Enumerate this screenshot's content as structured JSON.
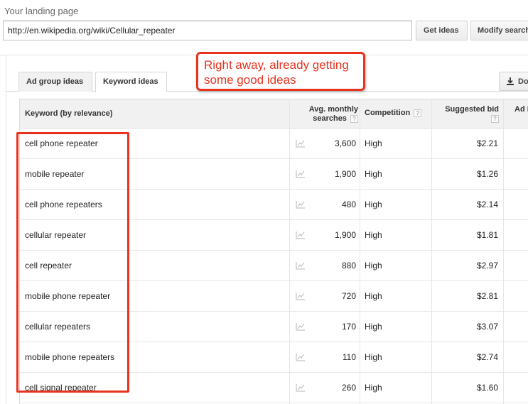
{
  "landing_page": {
    "label": "Your landing page",
    "url_value": "http://en.wikipedia.org/wiki/Cellular_repeater"
  },
  "buttons": {
    "get_ideas": "Get ideas",
    "modify_search": "Modify search",
    "download": "Download"
  },
  "tabs": [
    {
      "label": "Ad group ideas",
      "active": false
    },
    {
      "label": "Keyword ideas",
      "active": true
    }
  ],
  "table": {
    "headers": {
      "keyword": "Keyword (by relevance)",
      "avg_line1": "Avg. monthly",
      "avg_line2": "searches",
      "competition": "Competition",
      "bid": "Suggested bid",
      "ad_impr": "Ad i",
      "help": "?"
    },
    "rows": [
      {
        "keyword": "cell phone repeater",
        "searches": "3,600",
        "competition": "High",
        "bid": "$2.21"
      },
      {
        "keyword": "mobile repeater",
        "searches": "1,900",
        "competition": "High",
        "bid": "$1.26"
      },
      {
        "keyword": "cell phone repeaters",
        "searches": "480",
        "competition": "High",
        "bid": "$2.14"
      },
      {
        "keyword": "cellular repeater",
        "searches": "1,900",
        "competition": "High",
        "bid": "$1.81"
      },
      {
        "keyword": "cell repeater",
        "searches": "880",
        "competition": "High",
        "bid": "$2.97"
      },
      {
        "keyword": "mobile phone repeater",
        "searches": "720",
        "competition": "High",
        "bid": "$2.81"
      },
      {
        "keyword": "cellular repeaters",
        "searches": "170",
        "competition": "High",
        "bid": "$3.07"
      },
      {
        "keyword": "mobile phone repeaters",
        "searches": "110",
        "competition": "High",
        "bid": "$2.74"
      },
      {
        "keyword": "cell signal repeater",
        "searches": "260",
        "competition": "High",
        "bid": "$1.60"
      }
    ]
  },
  "annotation": {
    "line1": "Right away, already getting",
    "line2": "some good ideas",
    "color": "#e8331f"
  },
  "icons": {
    "trend": "trend-chart-icon",
    "download": "download-arrow-icon",
    "help": "help-icon"
  }
}
